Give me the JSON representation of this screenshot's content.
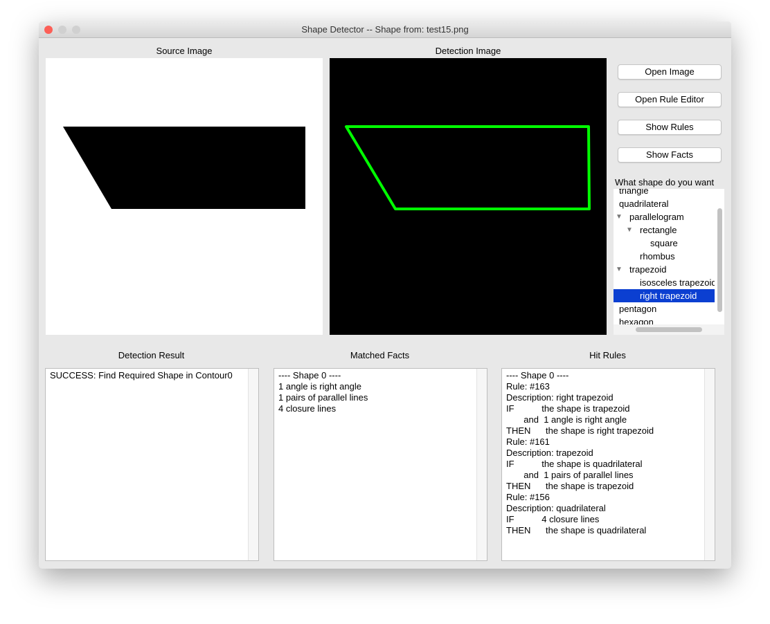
{
  "window": {
    "title": "Shape Detector -- Shape from: test15.png"
  },
  "panels": {
    "source_label": "Source Image",
    "detection_label": "Detection Image"
  },
  "colors": {
    "detection_outline": "#00ff00",
    "selection": "#0b3fd1",
    "close": "#fc5f57",
    "inactive": "#d0d0d0"
  },
  "buttons": {
    "open_image": "Open Image",
    "open_rule_editor": "Open Rule Editor",
    "show_rules": "Show Rules",
    "show_facts": "Show Facts"
  },
  "tree": {
    "label": "What shape do you want",
    "items": [
      {
        "label": "triangle",
        "level": 0
      },
      {
        "label": "quadrilateral",
        "level": 0
      },
      {
        "label": "parallelogram",
        "level": 1,
        "expanded": true
      },
      {
        "label": "rectangle",
        "level": 2,
        "expanded": true
      },
      {
        "label": "square",
        "level": 3
      },
      {
        "label": "rhombus",
        "level": 2
      },
      {
        "label": "trapezoid",
        "level": 1,
        "expanded": true
      },
      {
        "label": "isosceles trapezoid",
        "level": 2
      },
      {
        "label": "right trapezoid",
        "level": 2,
        "selected": true
      },
      {
        "label": "pentagon",
        "level": 0
      },
      {
        "label": "hexagon",
        "level": 0
      }
    ]
  },
  "result": {
    "label": "Detection Result",
    "text": "SUCCESS: Find Required Shape in Contour0"
  },
  "facts": {
    "label": "Matched Facts",
    "lines": [
      "---- Shape 0 ----",
      "1 angle is right angle",
      "1 pairs of parallel lines",
      "4 closure lines"
    ]
  },
  "rules": {
    "label": "Hit Rules",
    "lines": [
      "---- Shape 0 ----",
      "Rule: #163",
      "Description: right trapezoid",
      "IF           the shape is trapezoid",
      "       and  1 angle is right angle",
      "THEN      the shape is right trapezoid",
      "Rule: #161",
      "Description: trapezoid",
      "IF           the shape is quadrilateral",
      "       and  1 pairs of parallel lines",
      "THEN      the shape is trapezoid",
      "Rule: #156",
      "Description: quadrilateral",
      "IF           4 closure lines",
      "THEN      the shape is quadrilateral"
    ]
  }
}
